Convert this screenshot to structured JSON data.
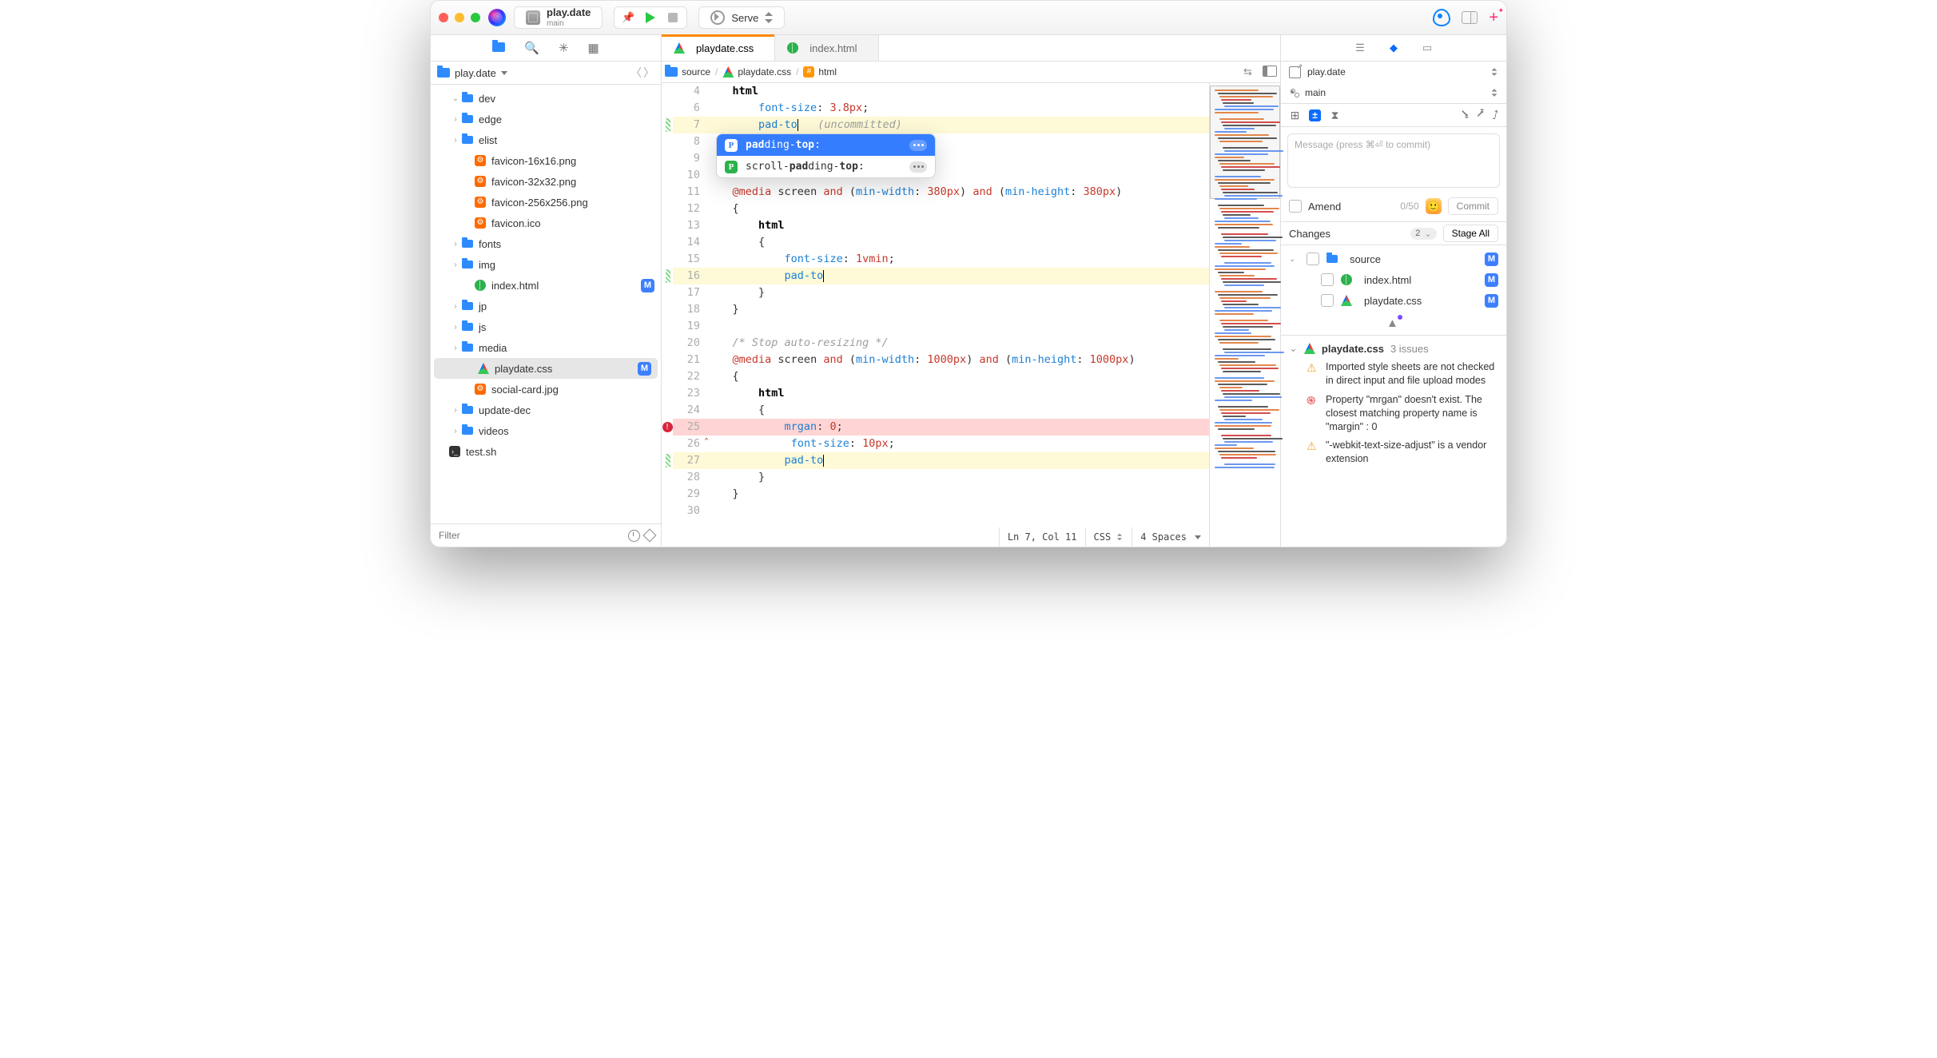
{
  "titlebar": {
    "project": {
      "name": "play.date",
      "branch": "main"
    },
    "serve_label": "Serve"
  },
  "sidebar": {
    "header": "play.date",
    "items": [
      {
        "kind": "folder",
        "name": "dev",
        "disclosure": "down",
        "indent": 1
      },
      {
        "kind": "folder",
        "name": "edge",
        "disclosure": "right",
        "indent": 1
      },
      {
        "kind": "folder",
        "name": "elist",
        "disclosure": "right",
        "indent": 1
      },
      {
        "kind": "gear",
        "name": "favicon-16x16.png",
        "indent": 2
      },
      {
        "kind": "gear",
        "name": "favicon-32x32.png",
        "indent": 2
      },
      {
        "kind": "gear",
        "name": "favicon-256x256.png",
        "indent": 2
      },
      {
        "kind": "gear",
        "name": "favicon.ico",
        "indent": 2
      },
      {
        "kind": "folder",
        "name": "fonts",
        "disclosure": "right",
        "indent": 1
      },
      {
        "kind": "folder",
        "name": "img",
        "disclosure": "right",
        "indent": 1
      },
      {
        "kind": "html",
        "name": "index.html",
        "indent": 2,
        "badge": "M"
      },
      {
        "kind": "folder",
        "name": "jp",
        "disclosure": "right",
        "indent": 1
      },
      {
        "kind": "folder",
        "name": "js",
        "disclosure": "right",
        "indent": 1
      },
      {
        "kind": "folder",
        "name": "media",
        "disclosure": "right",
        "indent": 1
      },
      {
        "kind": "css",
        "name": "playdate.css",
        "indent": 2,
        "badge": "M",
        "selected": true
      },
      {
        "kind": "gear",
        "name": "social-card.jpg",
        "indent": 2
      },
      {
        "kind": "folder",
        "name": "update-dec",
        "disclosure": "right",
        "indent": 1
      },
      {
        "kind": "folder",
        "name": "videos",
        "disclosure": "right",
        "indent": 1
      },
      {
        "kind": "sh",
        "name": "test.sh",
        "indent": 0
      }
    ],
    "filter_placeholder": "Filter"
  },
  "tabs": [
    {
      "label": "playdate.css",
      "icon": "css",
      "active": true
    },
    {
      "label": "index.html",
      "icon": "html"
    }
  ],
  "breadcrumbs": {
    "items": [
      {
        "icon": "folder",
        "label": "source"
      },
      {
        "icon": "css",
        "label": "playdate.css"
      },
      {
        "icon": "hash",
        "label": "html"
      }
    ]
  },
  "editor": {
    "lines": [
      {
        "n": 4,
        "html": "<span class='tok-b'>html</span>",
        "ind": 1
      },
      {
        "n": 6,
        "html": "<span class='pr'>font-size</span>: <span class='str'>3.8px</span>;",
        "ind": 2
      },
      {
        "n": 7,
        "html": "<span class='pr'>pad-to</span><span class='caret'></span>   <span class='cm'>(uncommitted)</span>",
        "ind": 2,
        "mark": "hash",
        "hl": "y"
      },
      {
        "n": 8,
        "html": "",
        "ind": 0
      },
      {
        "n": 9,
        "html": "",
        "ind": 0
      },
      {
        "n": 10,
        "html": "",
        "ind": 0
      },
      {
        "n": 11,
        "html": "<span class='kw'>@media</span> screen <span class='kw'>and</span> (<span class='pr'>min-width</span>: <span class='str'>380px</span>) <span class='kw'>and</span> (<span class='pr'>min-height</span>: <span class='str'>380px</span>)",
        "ind": 1
      },
      {
        "n": 12,
        "html": "{",
        "ind": 1
      },
      {
        "n": 13,
        "html": "<span class='tok-b'>html</span>",
        "ind": 2
      },
      {
        "n": 14,
        "html": "{",
        "ind": 2
      },
      {
        "n": 15,
        "html": "<span class='pr'>font-size</span>: <span class='str'>1vmin</span>;",
        "ind": 3
      },
      {
        "n": 16,
        "html": "<span class='pr'>pad-to</span><span class='caret'></span>",
        "ind": 3,
        "mark": "hash",
        "hl": "y"
      },
      {
        "n": 17,
        "html": "}",
        "ind": 2
      },
      {
        "n": 18,
        "html": "}",
        "ind": 1
      },
      {
        "n": 19,
        "html": "",
        "ind": 0
      },
      {
        "n": 20,
        "html": "<span class='cm'>/* Stop auto-resizing */</span>",
        "ind": 1
      },
      {
        "n": 21,
        "html": "<span class='kw'>@media</span> screen <span class='kw'>and</span> (<span class='pr'>min-width</span>: <span class='str'>1000px</span>) <span class='kw'>and</span> (<span class='pr'>min-height</span>: <span class='str'>1000px</span>)",
        "ind": 1
      },
      {
        "n": 22,
        "html": "{",
        "ind": 1
      },
      {
        "n": 23,
        "html": "<span class='tok-b'>html</span>",
        "ind": 2
      },
      {
        "n": 24,
        "html": "{",
        "ind": 2
      },
      {
        "n": 25,
        "html": "<span class='pr'>mrgan</span>: <span class='str'>0</span>;",
        "ind": 3,
        "mark": "err",
        "hl": "r"
      },
      {
        "n": 26,
        "html": "<span class='pr'>font-size</span>: <span class='str'>10px</span>;",
        "ind": 3,
        "caret_left": true
      },
      {
        "n": 27,
        "html": "<span class='pr'>pad-to</span><span class='caret'></span>",
        "ind": 3,
        "mark": "hash",
        "hl": "y"
      },
      {
        "n": 28,
        "html": "}",
        "ind": 2
      },
      {
        "n": 29,
        "html": "}",
        "ind": 1
      },
      {
        "n": 30,
        "html": "",
        "ind": 0
      }
    ],
    "popup": {
      "items": [
        {
          "bold1": "pad",
          "mid": "ding-",
          "bold2": "top",
          "tail": ":",
          "selected": true
        },
        {
          "pre": "scroll-",
          "bold1": "pad",
          "mid": "ding-",
          "bold2": "top",
          "tail": ":"
        }
      ]
    },
    "status": {
      "pos": "Ln 7, Col 11",
      "lang": "CSS",
      "indent": "4 Spaces"
    }
  },
  "right": {
    "repo": "play.date",
    "branch": "main",
    "msg_placeholder": "Message (press ⌘⏎ to commit)",
    "amend": "Amend",
    "counter": "0/50",
    "commit": "Commit",
    "changes_label": "Changes",
    "changes_count": "2",
    "stage_all": "Stage All",
    "changes": [
      {
        "icon": "folder",
        "label": "source",
        "badge": "M",
        "disc": "down"
      },
      {
        "icon": "html",
        "label": "index.html",
        "badge": "M",
        "indent": 1
      },
      {
        "icon": "css",
        "label": "playdate.css",
        "badge": "M",
        "indent": 1
      }
    ],
    "issues_file": "playdate.css",
    "issues_count": "3 issues",
    "issues": [
      {
        "type": "warn",
        "text": "Imported style sheets are not checked in direct input and file upload modes"
      },
      {
        "type": "error",
        "text": "Property \"mrgan\" doesn't exist. The closest matching property name is \"margin\" : 0"
      },
      {
        "type": "warn",
        "text": "\"-webkit-text-size-adjust\" is a vendor extension"
      }
    ]
  }
}
